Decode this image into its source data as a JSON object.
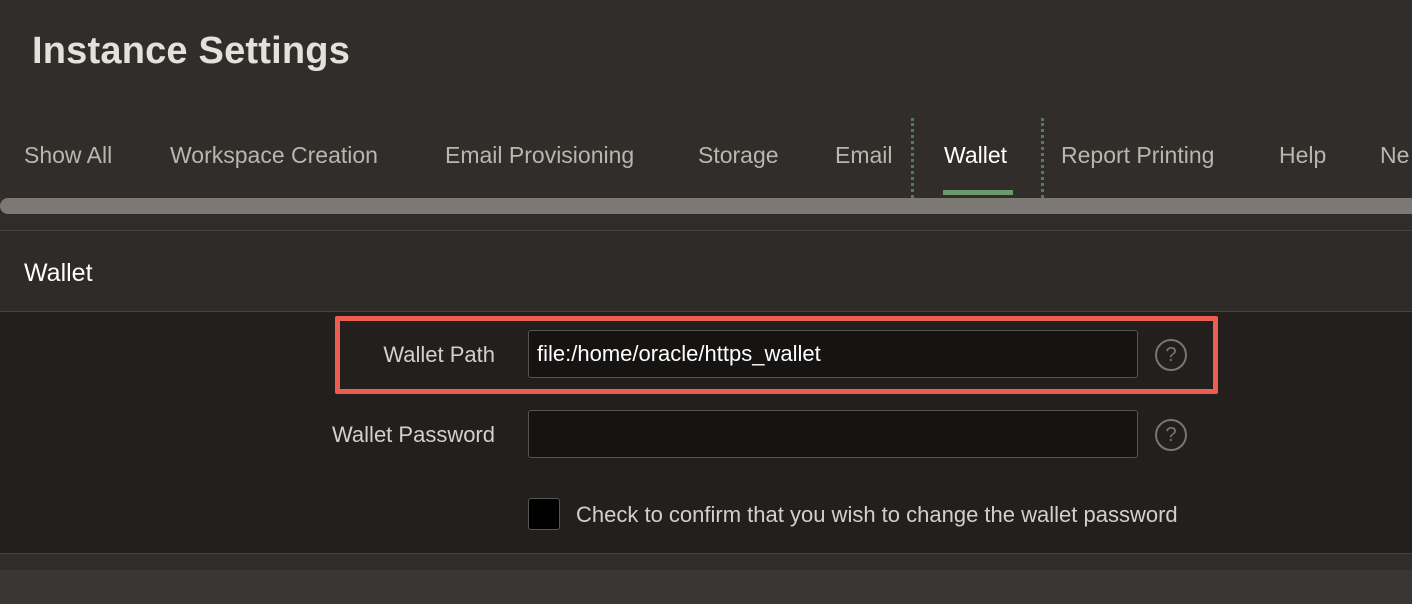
{
  "page": {
    "title": "Instance Settings"
  },
  "tabs": [
    {
      "label": "Show All",
      "active": false
    },
    {
      "label": "Workspace Creation",
      "active": false
    },
    {
      "label": "Email Provisioning",
      "active": false
    },
    {
      "label": "Storage",
      "active": false
    },
    {
      "label": "Email",
      "active": false
    },
    {
      "label": "Wallet",
      "active": true
    },
    {
      "label": "Report Printing",
      "active": false
    },
    {
      "label": "Help",
      "active": false
    },
    {
      "label": "Ne",
      "active": false
    }
  ],
  "region": {
    "title": "Wallet"
  },
  "fields": {
    "wallet_path": {
      "label": "Wallet Path",
      "value": "file:/home/oracle/https_wallet",
      "help_icon": "question-circle-icon"
    },
    "wallet_password": {
      "label": "Wallet Password",
      "value": "",
      "help_icon": "question-circle-icon"
    },
    "confirm_change": {
      "label": "Check to confirm that you wish to change the wallet password",
      "checked": false
    }
  },
  "icons": {
    "help_glyph": "?"
  },
  "colors": {
    "active_tab_underline": "#6d9a6a",
    "highlight_border": "#ec5e51",
    "background": "#302d2a"
  }
}
